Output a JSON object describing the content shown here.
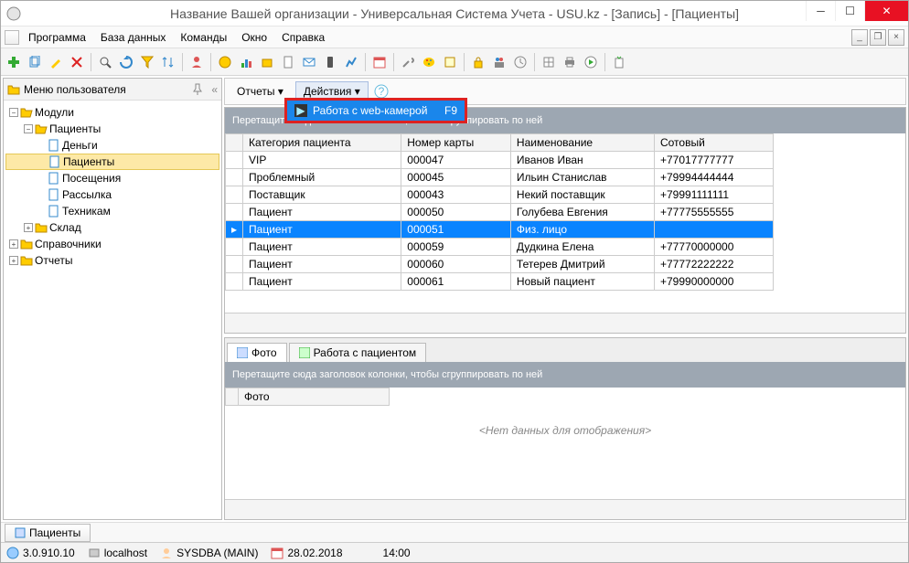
{
  "title": "Название Вашей организации - Универсальная Система Учета - USU.kz - [Запись] - [Пациенты]",
  "menu": {
    "items": [
      "Программа",
      "База данных",
      "Команды",
      "Окно",
      "Справка"
    ]
  },
  "sidebar": {
    "header": "Меню пользователя",
    "nodes": {
      "modules": "Модули",
      "patients_group": "Пациенты",
      "money": "Деньги",
      "patients": "Пациенты",
      "visits": "Посещения",
      "mailing": "Рассылка",
      "tech": "Техникам",
      "warehouse": "Склад",
      "refs": "Справочники",
      "reports": "Отчеты"
    }
  },
  "subtoolbar": {
    "reports": "Отчеты",
    "actions": "Действия",
    "dropdown": {
      "label": "Работа с web-камерой",
      "hotkey": "F9"
    }
  },
  "grid": {
    "group_hint": "Перетащите сюда заголовок колонки, чтобы сгруппировать по ней",
    "columns": [
      "Категория пациента",
      "Номер карты",
      "Наименование",
      "Сотовый"
    ],
    "rows": [
      {
        "cat": "VIP",
        "card": "000047",
        "name": "Иванов Иван",
        "phone": "+77017777777"
      },
      {
        "cat": "Проблемный",
        "card": "000045",
        "name": "Ильин Станислав",
        "phone": "+79994444444"
      },
      {
        "cat": "Поставщик",
        "card": "000043",
        "name": "Некий поставщик",
        "phone": "+79991111111"
      },
      {
        "cat": "Пациент",
        "card": "000050",
        "name": "Голубева Евгения",
        "phone": "+77775555555"
      },
      {
        "cat": "Пациент",
        "card": "000051",
        "name": "Физ. лицо",
        "phone": ""
      },
      {
        "cat": "Пациент",
        "card": "000059",
        "name": "Дудкина Елена",
        "phone": "+77770000000"
      },
      {
        "cat": "Пациент",
        "card": "000060",
        "name": "Тетерев Дмитрий",
        "phone": "+77772222222"
      },
      {
        "cat": "Пациент",
        "card": "000061",
        "name": "Новый пациент",
        "phone": "+79990000000"
      }
    ],
    "selected_index": 4
  },
  "lower": {
    "tabs": [
      "Фото",
      "Работа с пациентом"
    ],
    "group_hint": "Перетащите сюда заголовок колонки, чтобы сгруппировать по ней",
    "photo_col": "Фото",
    "nodata": "<Нет данных для отображения>"
  },
  "bottom_tab": "Пациенты",
  "status": {
    "version": "3.0.910.10",
    "host": "localhost",
    "user": "SYSDBA (MAIN)",
    "date": "28.02.2018",
    "time": "14:00"
  }
}
